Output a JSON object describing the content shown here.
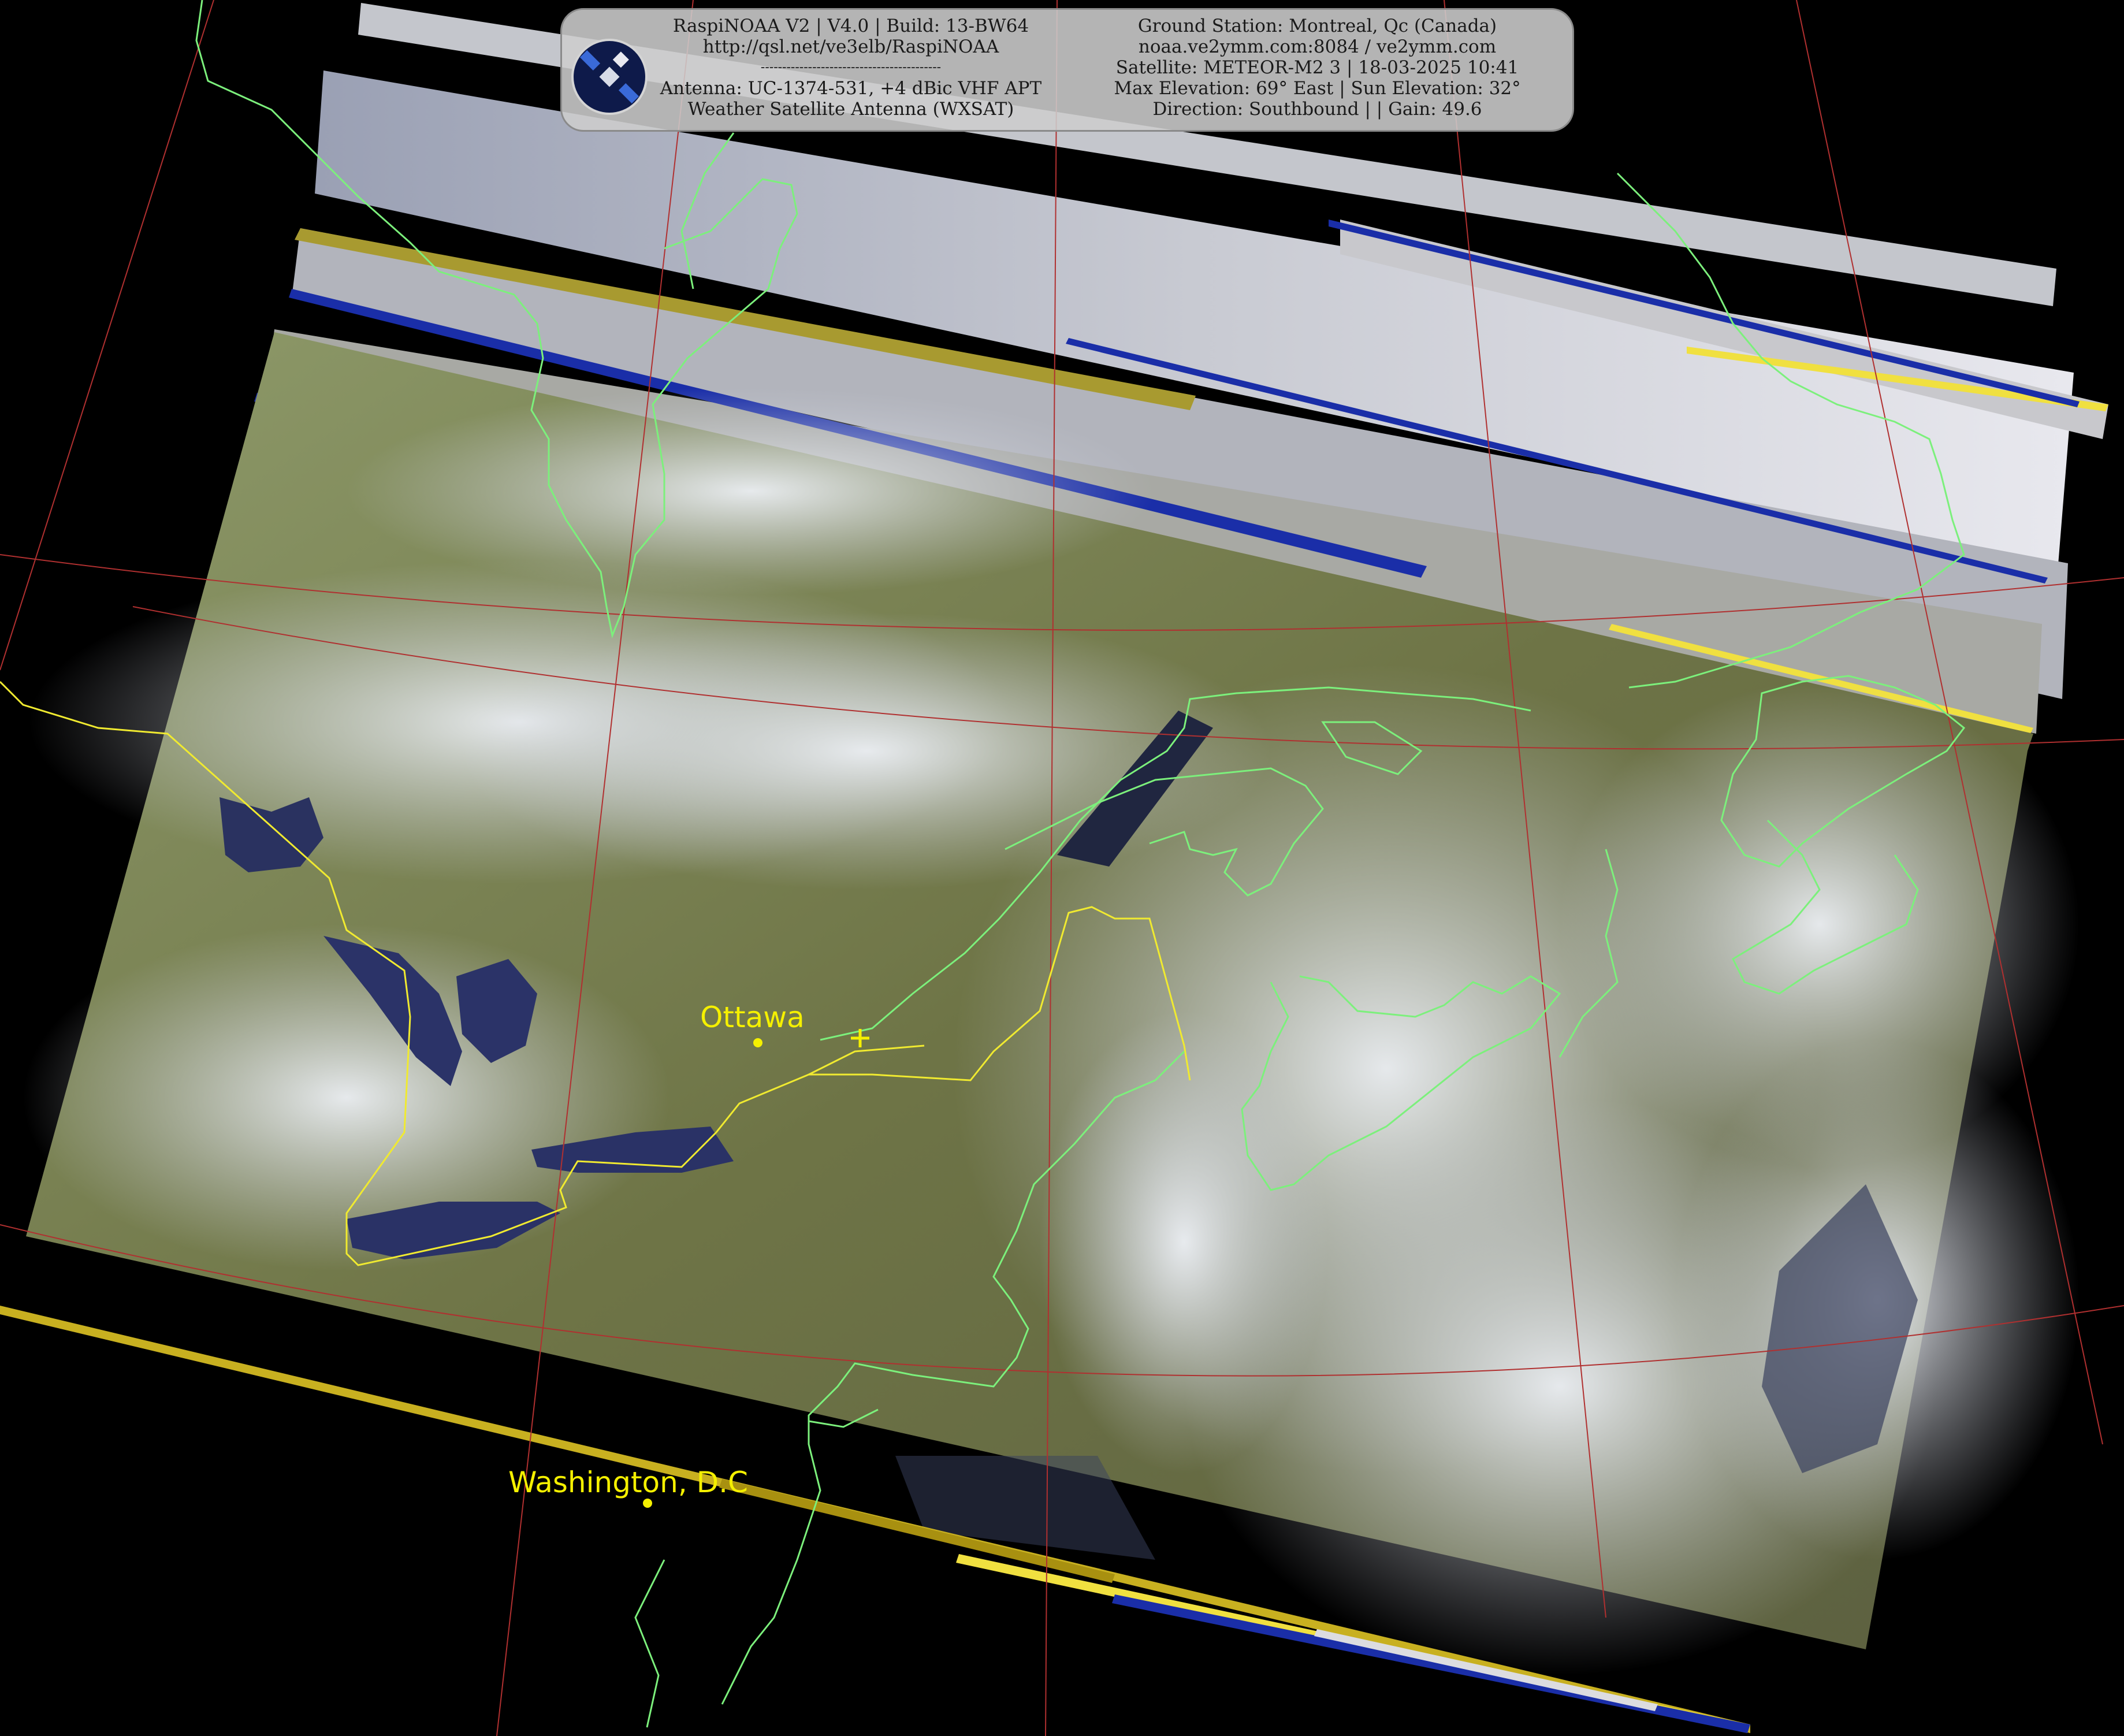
{
  "header": {
    "left_lines": [
      "RaspiNOAA V2 | V4.0 | Build: 13-BW64",
      "http://qsl.net/ve3elb/RaspiNOAA",
      "------------------------------------------",
      "Antenna: UC-1374-531, +4 dBic VHF APT",
      "Weather Satellite Antenna (WXSAT)"
    ],
    "right_lines": [
      "Ground Station: Montreal, Qc (Canada)",
      "noaa.ve2ymm.com:8084 / ve2ymm.com",
      "Satellite: METEOR-M2 3 | 18-03-2025 10:41",
      "Max Elevation: 69° East | Sun Elevation: 32°",
      "Direction: Southbound | | Gain: 49.6"
    ],
    "logo_icon": "satellite-icon"
  },
  "labels": {
    "ottawa": "Ottawa",
    "washington": "Washington, D.C",
    "station_marker": "ground-station-cross-icon"
  },
  "colors": {
    "coastline": "#7cf07c",
    "border": "#f0ea30",
    "graticule": "#b03030",
    "city": "#f5f000"
  }
}
